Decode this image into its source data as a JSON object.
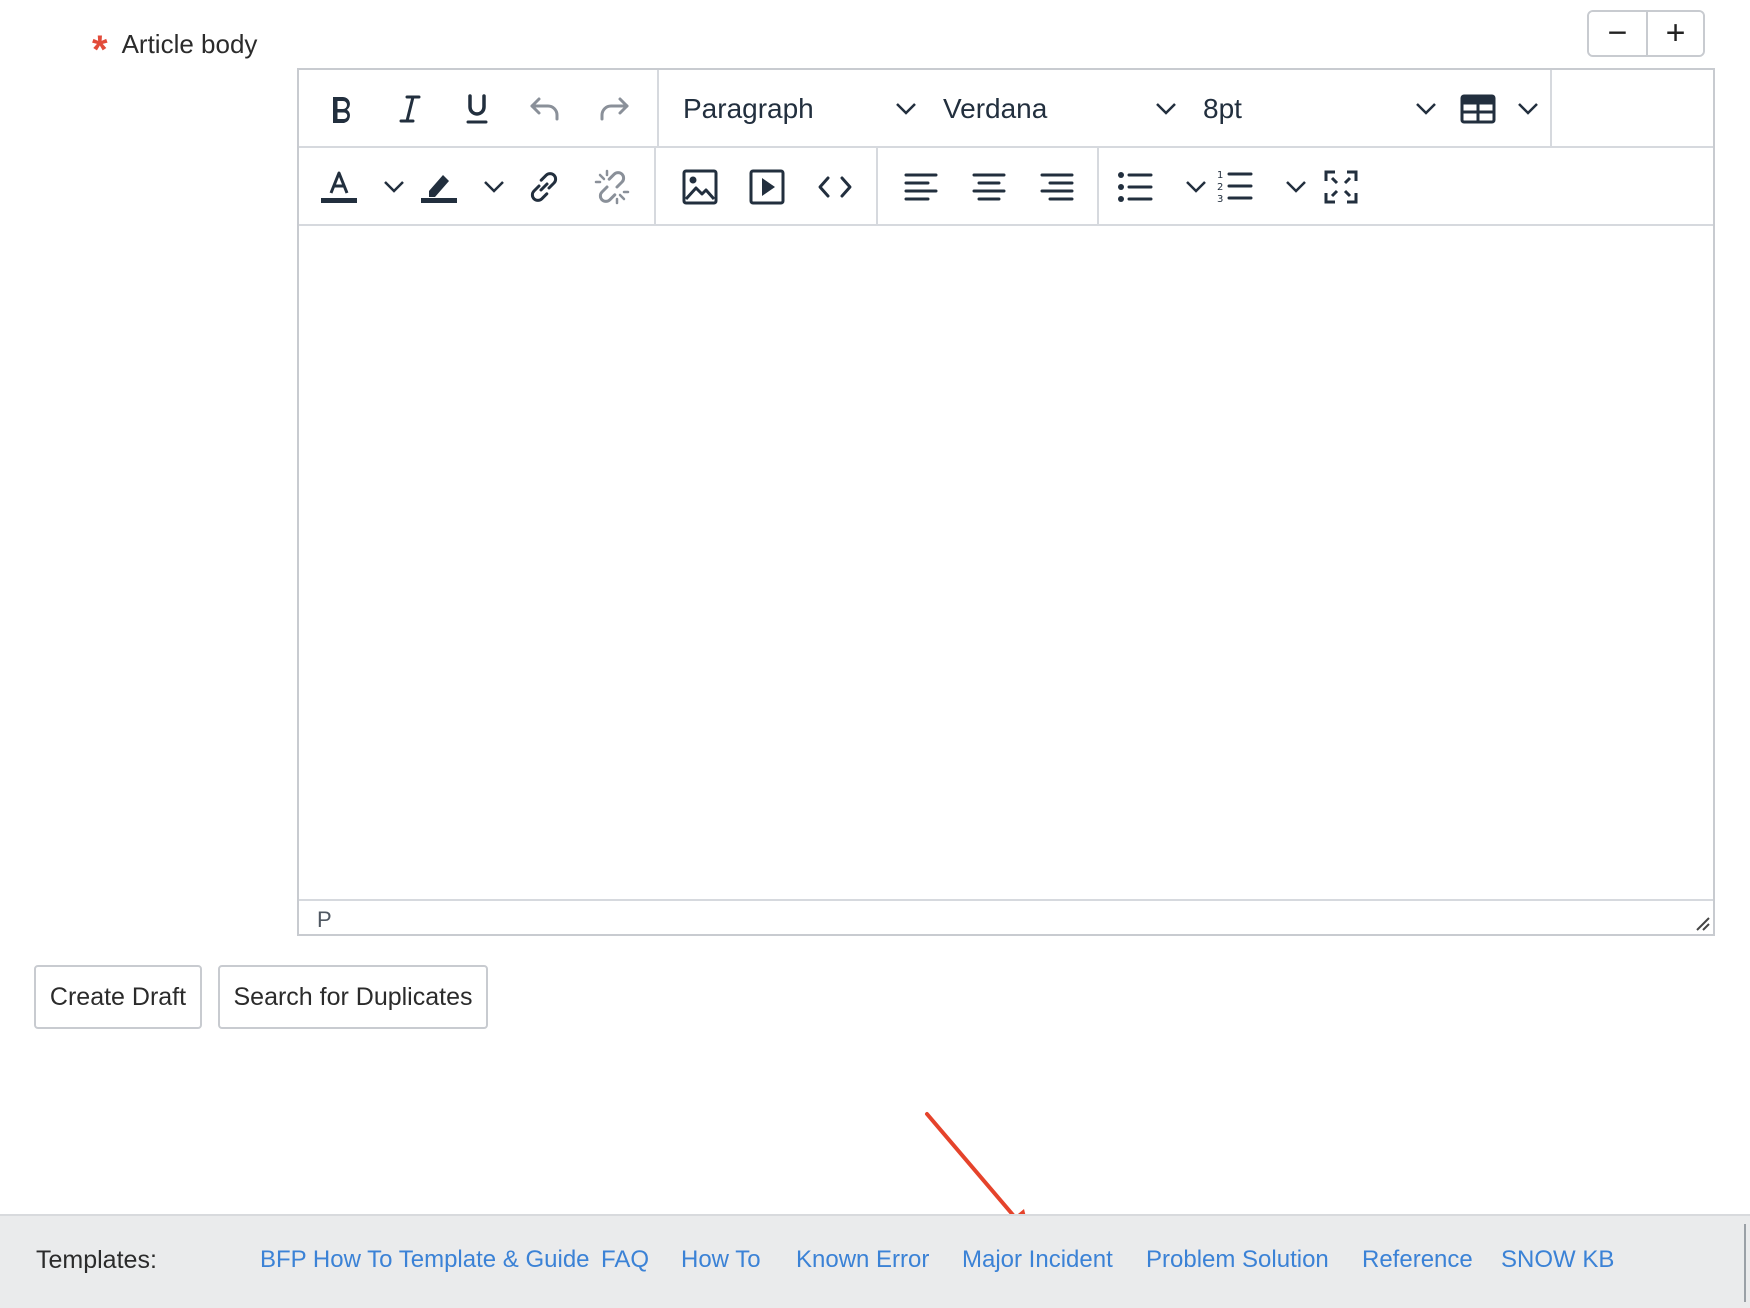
{
  "field": {
    "label": "Article body",
    "required_marker": "*"
  },
  "zoom": {
    "decrease_label": "−",
    "increase_label": "+"
  },
  "toolbar": {
    "format_block": "Paragraph",
    "font_family": "Verdana",
    "font_size": "8pt",
    "icons": [
      "bold-icon",
      "italic-icon",
      "underline-icon",
      "undo-icon",
      "redo-icon",
      "table-icon",
      "text-color-icon",
      "highlight-icon",
      "link-icon",
      "unlink-icon",
      "image-icon",
      "media-icon",
      "code-icon",
      "align-left-icon",
      "align-center-icon",
      "align-right-icon",
      "bullet-list-icon",
      "numbered-list-icon",
      "fullscreen-icon"
    ]
  },
  "statusbar": {
    "path": "P"
  },
  "actions": {
    "create_draft": "Create Draft",
    "search_duplicates": "Search for Duplicates"
  },
  "footer": {
    "label": "Templates:",
    "templates": [
      "BFP How To Template & Guide",
      "FAQ",
      "How To",
      "Known Error",
      "Major Incident",
      "Problem Solution",
      "Reference",
      "SNOW KB"
    ]
  },
  "colors": {
    "link": "#3b82d6",
    "required": "#e24b3a",
    "annotation_arrow": "#e5432b",
    "footer_bg": "#eaebec"
  }
}
